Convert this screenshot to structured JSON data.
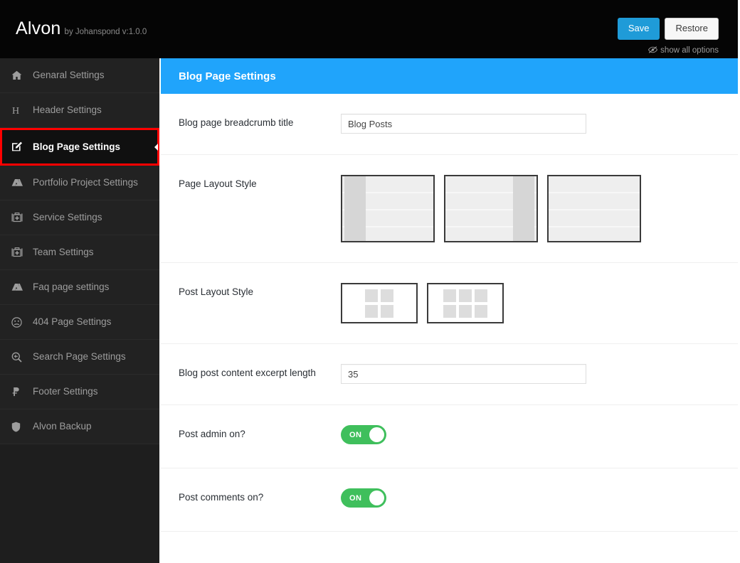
{
  "topbar": {
    "brand_name": "Alvon",
    "brand_sub": "by Johanspond v:1.0.0",
    "save_label": "Save",
    "restore_label": "Restore",
    "show_all_label": "show all options",
    "eye_icon": "eye-slash-icon",
    "background": "#050505",
    "save_color": "#1f9bd8"
  },
  "sidebar": {
    "background": "#222222",
    "active_outline_color": "#ff0000",
    "items": [
      {
        "label": "Genaral Settings",
        "icon": "home-icon",
        "active": false
      },
      {
        "label": "Header Settings",
        "icon": "heading-icon",
        "active": false
      },
      {
        "label": "Blog Page Settings",
        "icon": "pencil-square-icon",
        "active": true
      },
      {
        "label": "Portfolio Project Settings",
        "icon": "delicious-icon",
        "active": false
      },
      {
        "label": "Service Settings",
        "icon": "briefcase-medical-icon",
        "active": false
      },
      {
        "label": "Team Settings",
        "icon": "briefcase-medical-icon",
        "active": false
      },
      {
        "label": "Faq page settings",
        "icon": "delicious-icon",
        "active": false
      },
      {
        "label": "404 Page Settings",
        "icon": "frown-icon",
        "active": false
      },
      {
        "label": "Search Page Settings",
        "icon": "search-plus-icon",
        "active": false
      },
      {
        "label": "Footer Settings",
        "icon": "ruble-icon",
        "active": false
      },
      {
        "label": "Alvon Backup",
        "icon": "shield-icon",
        "active": false
      }
    ]
  },
  "content": {
    "section_title": "Blog Page Settings",
    "section_color": "#20a4fb",
    "fields": {
      "breadcrumb": {
        "label": "Blog page breadcrumb title",
        "value": "Blog Posts",
        "placeholder": ""
      },
      "page_layout": {
        "label": "Page Layout Style",
        "options": [
          {
            "name": "left-sidebar-layout",
            "selected": false
          },
          {
            "name": "right-sidebar-layout",
            "selected": false
          },
          {
            "name": "full-width-layout",
            "selected": false
          }
        ]
      },
      "post_layout": {
        "label": "Post Layout Style",
        "options": [
          {
            "name": "two-column-grid",
            "columns": 2,
            "rows": 2,
            "selected": false
          },
          {
            "name": "three-column-grid",
            "columns": 3,
            "rows": 2,
            "selected": false
          }
        ]
      },
      "excerpt_length": {
        "label": "Blog post content excerpt length",
        "value": "35",
        "placeholder": ""
      },
      "post_admin": {
        "label": "Post admin on?",
        "state": "ON",
        "on_color": "#3fbf5c"
      },
      "post_comments": {
        "label": "Post comments on?",
        "state": "ON",
        "on_color": "#3fbf5c"
      }
    }
  }
}
